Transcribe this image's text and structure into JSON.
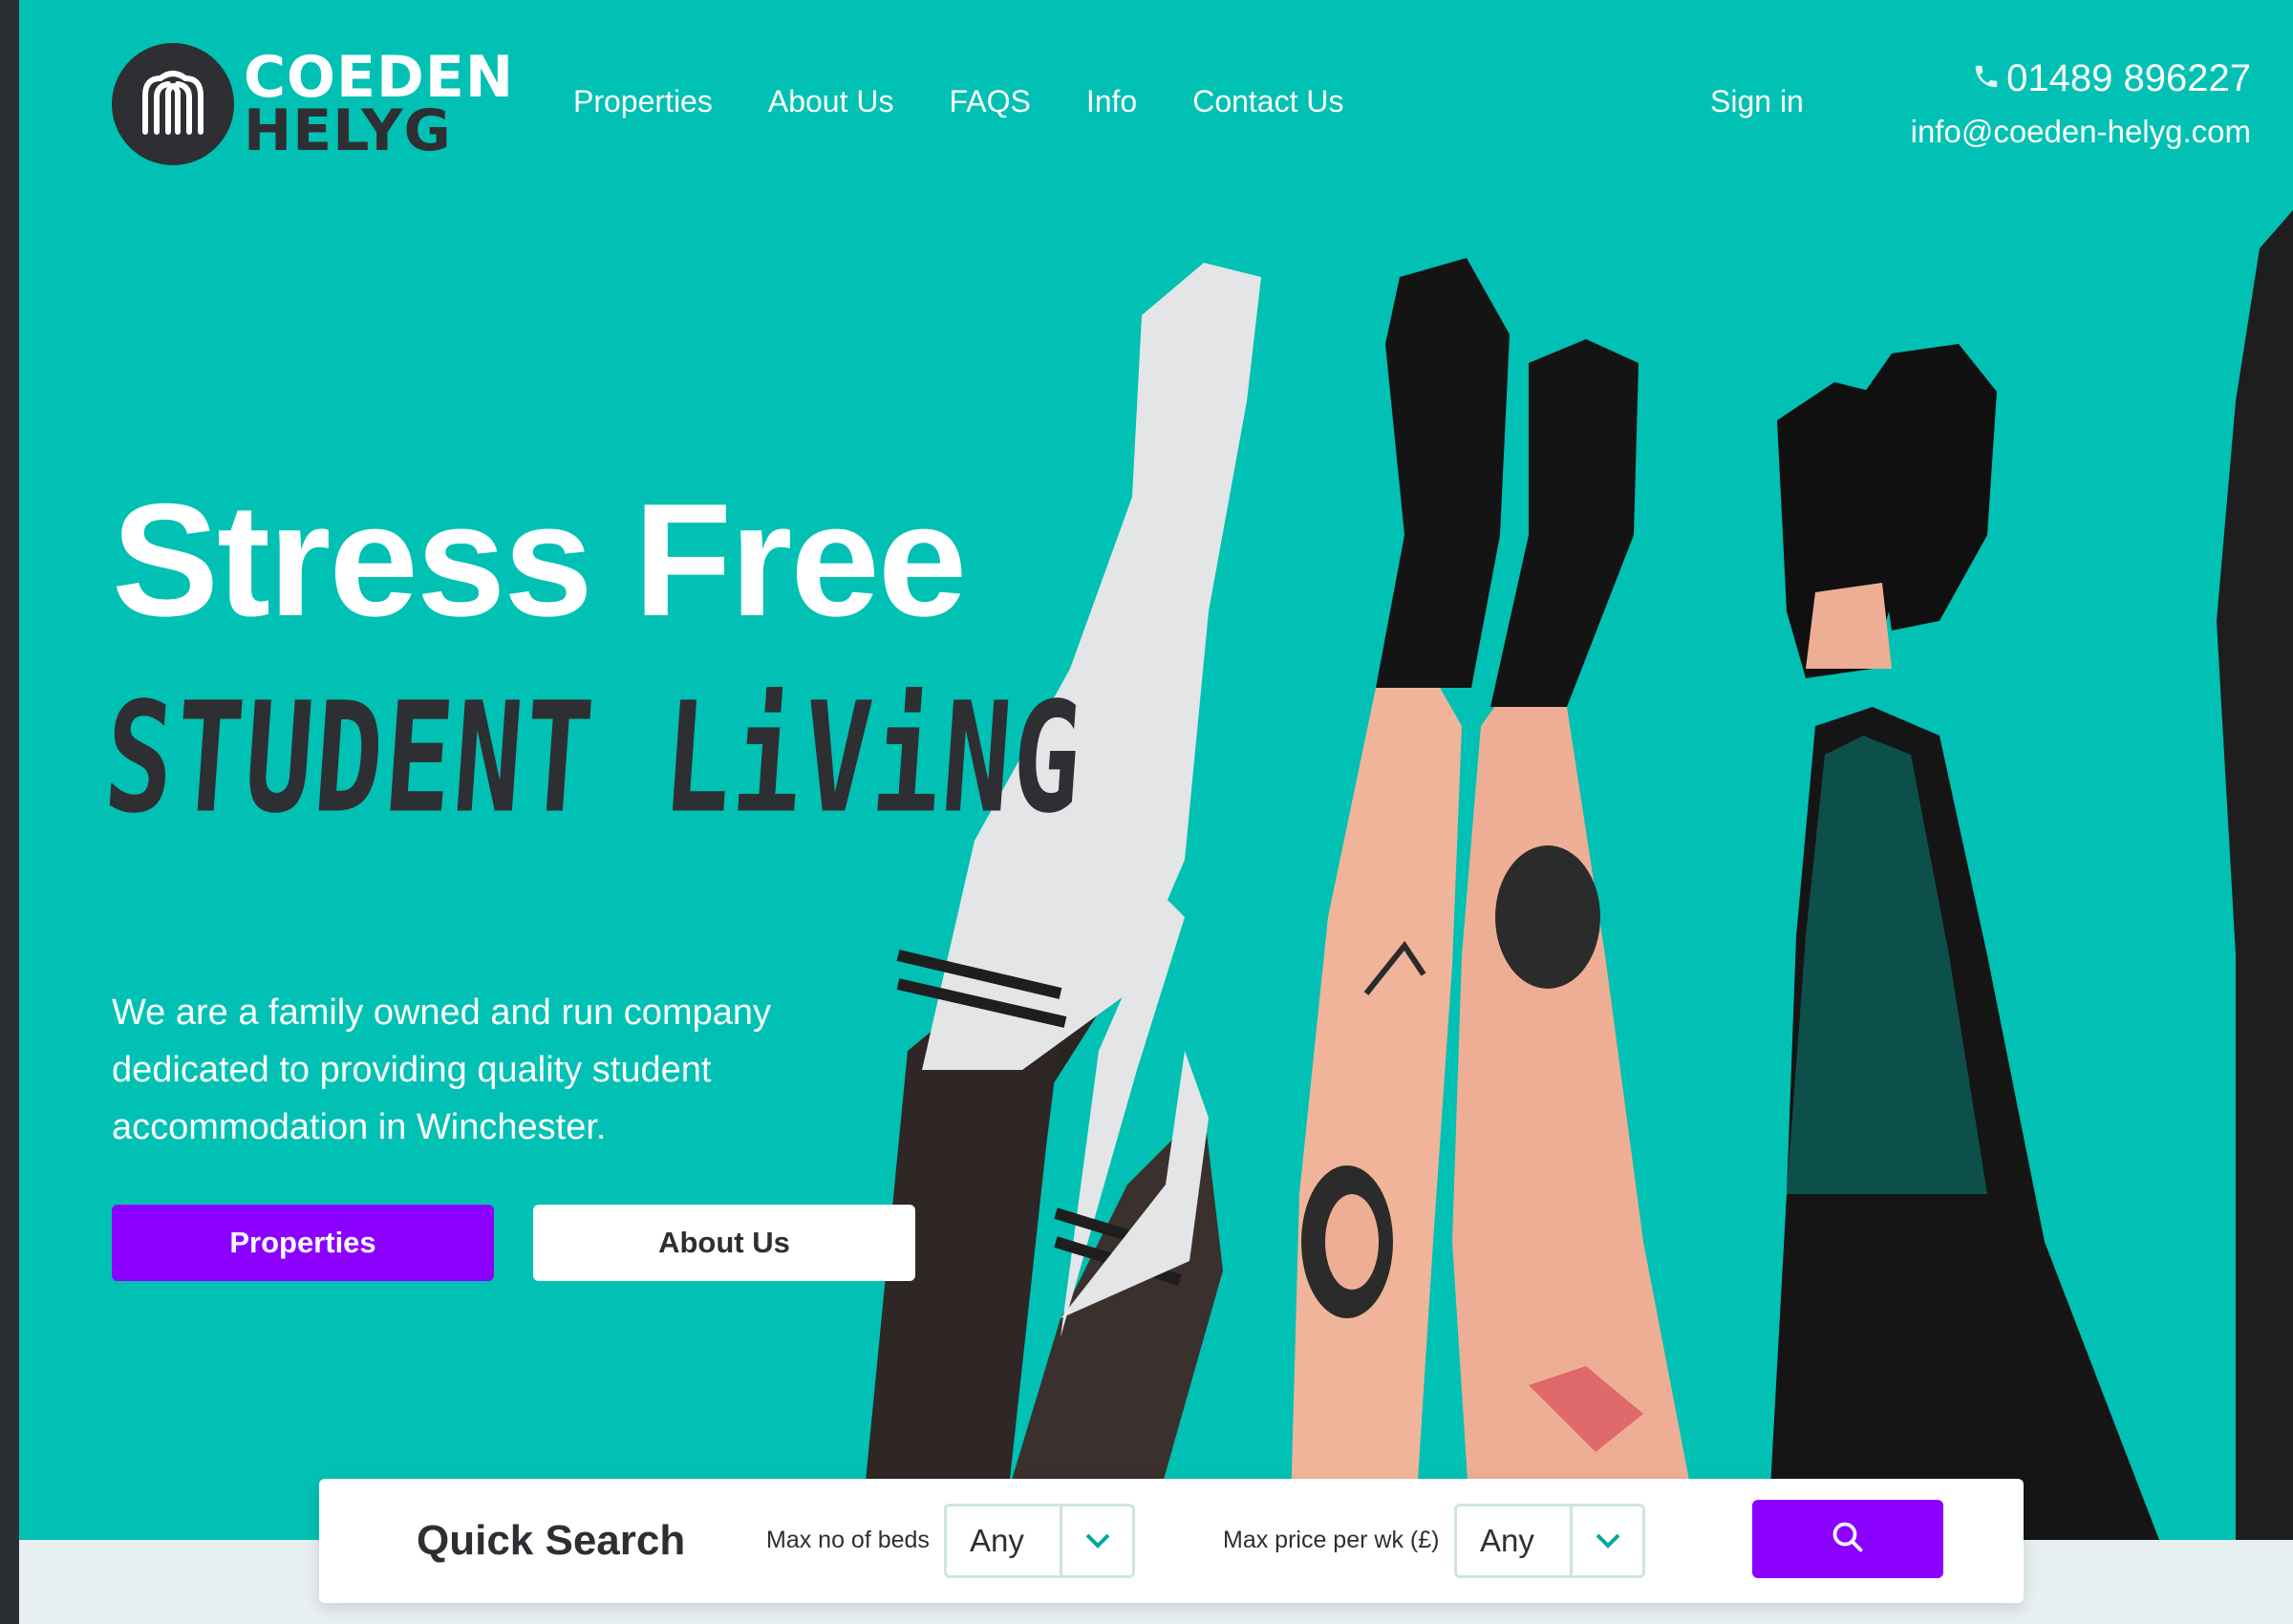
{
  "brand": {
    "line1": "COEDEN",
    "line2": "HELYG",
    "accent": "#00c1b3",
    "dark": "#2e2f33",
    "purple": "#8c00ff"
  },
  "nav": {
    "items": [
      "Properties",
      "About Us",
      "FAQS",
      "Info",
      "Contact Us"
    ],
    "signin": "Sign in"
  },
  "contact": {
    "phone": "01489 896227",
    "email": "info@coeden-helyg.com",
    "phone_icon": "phone-icon"
  },
  "hero": {
    "title": "Stress Free",
    "subtitle": "STUDENT LiViNG",
    "intro": "We are a family owned and run company dedicated to providing quality student accommodation in Winchester.",
    "primary_button": "Properties",
    "secondary_button": "About Us"
  },
  "quick_search": {
    "title": "Quick Search",
    "beds_label": "Max no of beds",
    "beds_value": "Any",
    "price_label": "Max price per wk (£)",
    "price_value": "Any",
    "search_icon": "search-icon"
  }
}
